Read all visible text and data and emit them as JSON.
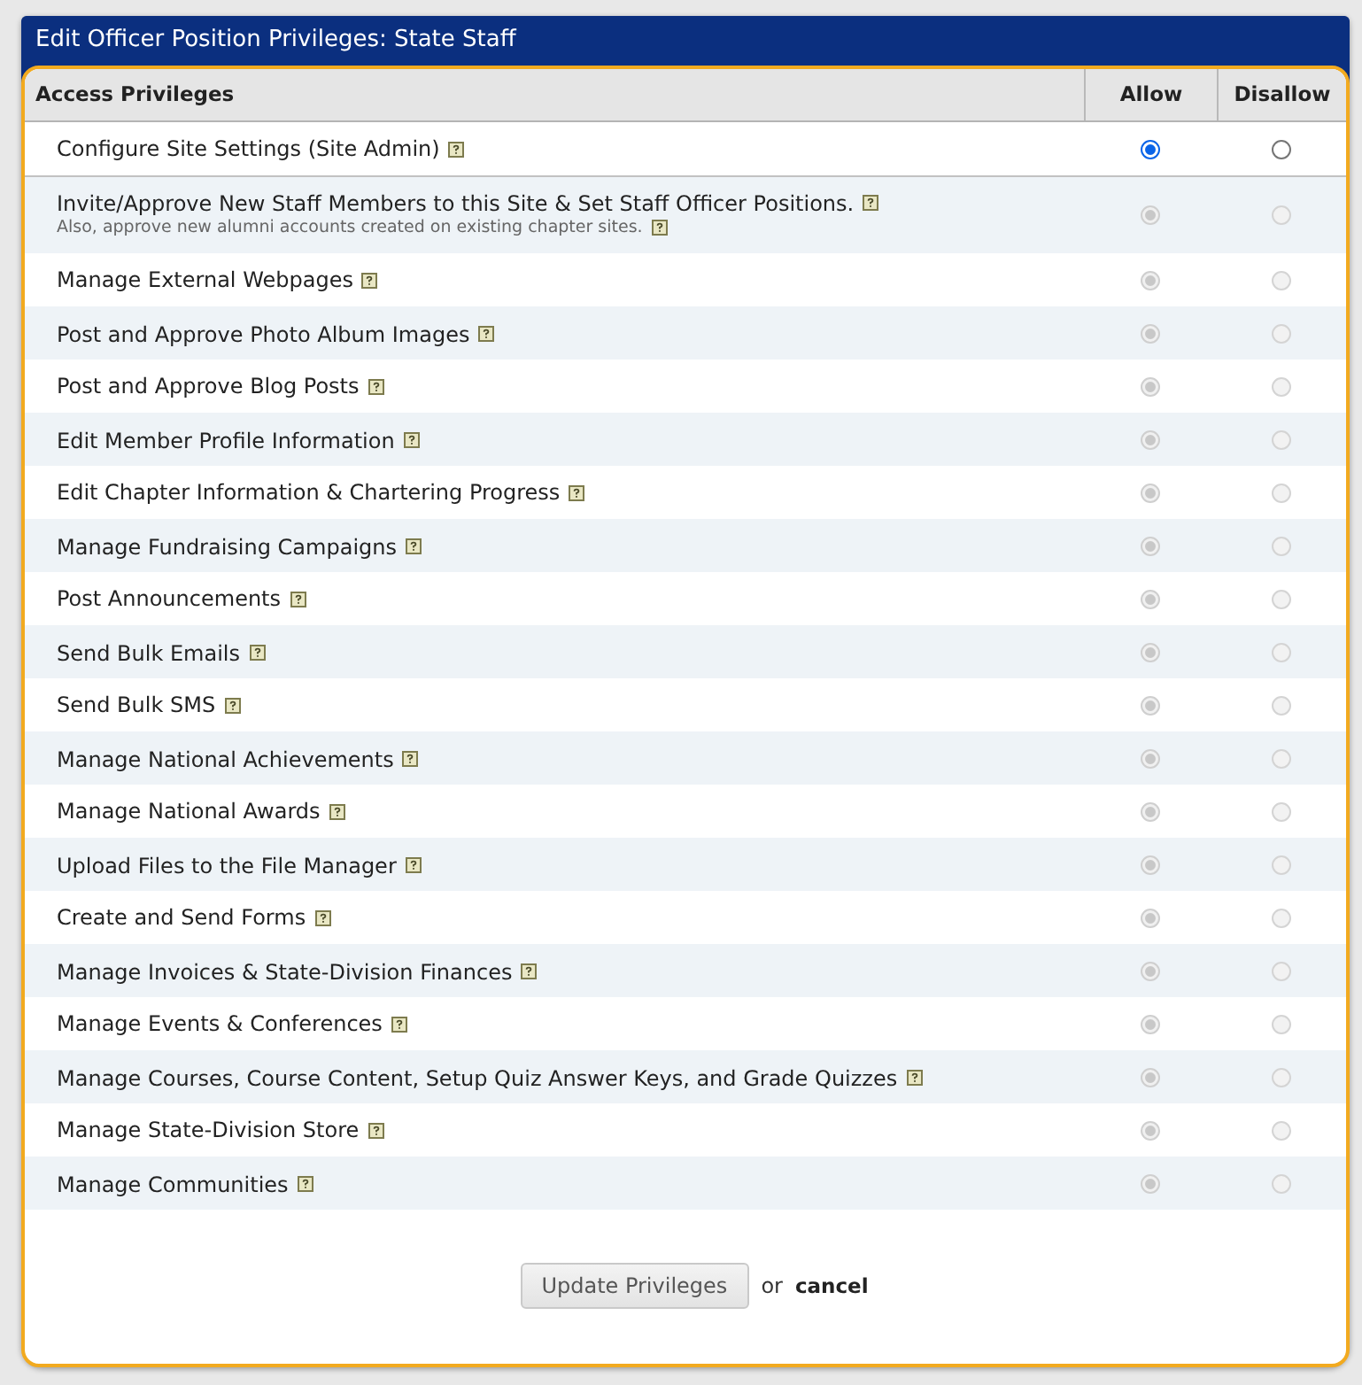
{
  "window": {
    "title": "Edit Officer Position Privileges: State Staff"
  },
  "table": {
    "columns": [
      "Access Privileges",
      "Allow",
      "Disallow"
    ],
    "rows": [
      {
        "label": "Configure Site Settings (Site Admin)",
        "disabled": false,
        "options": [
          {
            "selected": true
          },
          {
            "selected": false
          }
        ]
      },
      {
        "label": "Invite/Approve New Staff Members to this Site & Set Staff Officer Positions.",
        "note": "Also, approve new alumni accounts created on existing chapter sites.",
        "disabled": true,
        "options": [
          {
            "selected": true
          },
          {
            "selected": false
          }
        ]
      },
      {
        "label": "Manage External Webpages",
        "disabled": true,
        "options": [
          {
            "selected": true
          },
          {
            "selected": false
          }
        ]
      },
      {
        "label": "Post and Approve Photo Album Images",
        "disabled": true,
        "options": [
          {
            "selected": true
          },
          {
            "selected": false
          }
        ]
      },
      {
        "label": "Post and Approve Blog Posts",
        "disabled": true,
        "options": [
          {
            "selected": true
          },
          {
            "selected": false
          }
        ]
      },
      {
        "label": "Edit Member Profile Information",
        "disabled": true,
        "options": [
          {
            "selected": true
          },
          {
            "selected": false
          }
        ]
      },
      {
        "label": "Edit Chapter Information & Chartering Progress",
        "disabled": true,
        "options": [
          {
            "selected": true
          },
          {
            "selected": false
          }
        ]
      },
      {
        "label": "Manage Fundraising Campaigns",
        "disabled": true,
        "options": [
          {
            "selected": true
          },
          {
            "selected": false
          }
        ]
      },
      {
        "label": "Post Announcements",
        "disabled": true,
        "options": [
          {
            "selected": true
          },
          {
            "selected": false
          }
        ]
      },
      {
        "label": "Send Bulk Emails",
        "disabled": true,
        "options": [
          {
            "selected": true
          },
          {
            "selected": false
          }
        ]
      },
      {
        "label": "Send Bulk SMS",
        "disabled": true,
        "options": [
          {
            "selected": true
          },
          {
            "selected": false
          }
        ]
      },
      {
        "label": "Manage National Achievements",
        "disabled": true,
        "options": [
          {
            "selected": true
          },
          {
            "selected": false
          }
        ]
      },
      {
        "label": "Manage National Awards",
        "disabled": true,
        "options": [
          {
            "selected": true
          },
          {
            "selected": false
          }
        ]
      },
      {
        "label": "Upload Files to the File Manager",
        "disabled": true,
        "options": [
          {
            "selected": true
          },
          {
            "selected": false
          }
        ]
      },
      {
        "label": "Create and Send Forms",
        "disabled": true,
        "options": [
          {
            "selected": true
          },
          {
            "selected": false
          }
        ]
      },
      {
        "label": "Manage Invoices & State-Division Finances",
        "disabled": true,
        "options": [
          {
            "selected": true
          },
          {
            "selected": false
          }
        ]
      },
      {
        "label": "Manage Events & Conferences",
        "disabled": true,
        "options": [
          {
            "selected": true
          },
          {
            "selected": false
          }
        ]
      },
      {
        "label": "Manage Courses, Course Content, Setup Quiz Answer Keys, and Grade Quizzes",
        "disabled": true,
        "options": [
          {
            "selected": true
          },
          {
            "selected": false
          }
        ]
      },
      {
        "label": "Manage State-Division Store",
        "disabled": true,
        "options": [
          {
            "selected": true
          },
          {
            "selected": false
          }
        ]
      },
      {
        "label": "Manage Communities",
        "disabled": true,
        "options": [
          {
            "selected": true
          },
          {
            "selected": false
          }
        ]
      }
    ]
  },
  "actions": {
    "submit": "Update Privileges",
    "separator": "or",
    "cancel": "cancel"
  }
}
